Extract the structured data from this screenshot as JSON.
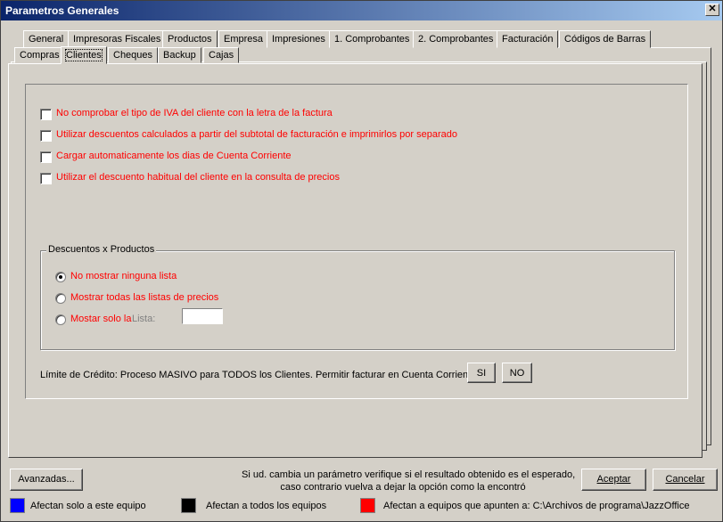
{
  "window": {
    "title": "Parametros Generales",
    "close_glyph": "✕"
  },
  "tabs_row1": [
    "General",
    "Impresoras Fiscales",
    "Productos",
    "Empresa",
    "Impresiones",
    "1. Comprobantes",
    "2. Comprobantes",
    "Facturación",
    "Códigos de Barras"
  ],
  "tabs_row2": [
    "Compras",
    "Clientes",
    "Cheques",
    "Backup",
    "Cajas"
  ],
  "active_tab": "Clientes",
  "checkboxes": [
    {
      "label": "No comprobar el tipo de IVA del cliente con la letra de la factura",
      "checked": false
    },
    {
      "label": "Utilizar descuentos calculados a partir del subtotal de facturación e imprimirlos por separado",
      "checked": false
    },
    {
      "label": "Cargar automaticamente los dias de Cuenta Corriente",
      "checked": false
    },
    {
      "label": "Utilizar el descuento habitual del cliente en la consulta de precios",
      "checked": false
    }
  ],
  "descuentos": {
    "title": "Descuentos x Productos",
    "options": [
      {
        "label": "No mostrar ninguna lista",
        "selected": true
      },
      {
        "label": "Mostrar todas las listas de precios",
        "selected": false
      },
      {
        "label": "Mostar solo la",
        "selected": false
      }
    ],
    "lista_label": "Lista:",
    "lista_value": ""
  },
  "credito": {
    "text": "Límite de Crédito: Proceso MASIVO para TODOS los Clientes. Permitir facturar en  Cuenta Corriente",
    "si_label": "SI",
    "no_label": "NO"
  },
  "footer": {
    "advanced_label": "Avanzadas...",
    "notice_line1": "Si ud. cambia un parámetro verifique si el resultado obtenido es el esperado,",
    "notice_line2": "caso contrario vuelva a dejar la opción como la encontró",
    "accept_label": "Aceptar",
    "cancel_label": "Cancelar"
  },
  "legend": [
    {
      "color": "#0000ff",
      "label": "Afectan solo a este equipo"
    },
    {
      "color": "#000000",
      "label": "Afectan a todos los equipos"
    },
    {
      "color": "#ff0000",
      "label": "Afectan a equipos que apunten a: C:\\Archivos de programa\\JazzOffice"
    }
  ]
}
